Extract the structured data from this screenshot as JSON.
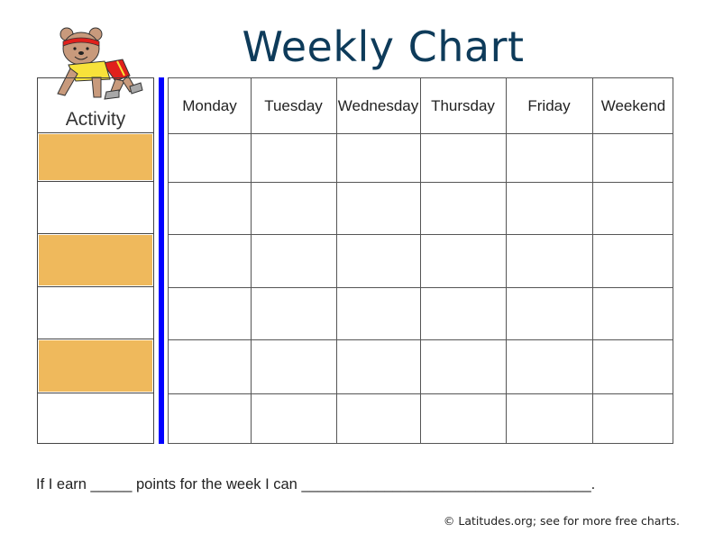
{
  "title": "Weekly Chart",
  "mascot": {
    "icon": "bear-exercising-icon",
    "colors": {
      "fur": "#c89a7c",
      "headband": "#e0201c",
      "shirt": "#f7e23a",
      "shorts": "#e0201c",
      "shoes": "#a8a8a8"
    }
  },
  "activity_column": {
    "header": "Activity",
    "rows": [
      {
        "label": "",
        "highlighted": true
      },
      {
        "label": "",
        "highlighted": false
      },
      {
        "label": "",
        "highlighted": true
      },
      {
        "label": "",
        "highlighted": false
      },
      {
        "label": "",
        "highlighted": true
      },
      {
        "label": "",
        "highlighted": false
      }
    ]
  },
  "days": [
    "Monday",
    "Tuesday",
    "Wednesday",
    "Thursday",
    "Friday",
    "Weekend"
  ],
  "grid_rows": 6,
  "colors": {
    "title": "#0e3b5a",
    "highlight": "#efb95c",
    "divider": "#0000ff"
  },
  "reward": {
    "prefix": "If I earn ",
    "points_blank": "_____",
    "middle": " points for the week I can ",
    "reward_blank": "___________________________________",
    "suffix": "."
  },
  "footer": "© Latitudes.org; see for more free charts."
}
